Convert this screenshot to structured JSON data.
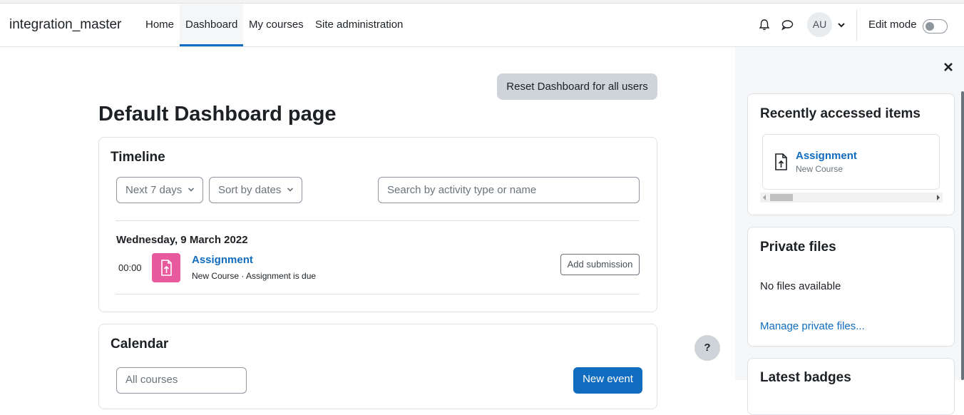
{
  "navbar": {
    "brand": "integration_master",
    "links": [
      "Home",
      "Dashboard",
      "My courses",
      "Site administration"
    ],
    "active": "Dashboard",
    "avatar_initials": "AU",
    "edit_mode_label": "Edit mode",
    "edit_mode_on": false
  },
  "page": {
    "reset_button": "Reset Dashboard for all users",
    "title": "Default Dashboard page"
  },
  "timeline": {
    "title": "Timeline",
    "day_filter": "Next 7 days",
    "sort": "Sort by dates",
    "search_placeholder": "Search by activity type or name",
    "date_heading": "Wednesday, 9 March 2022",
    "item": {
      "time": "00:00",
      "name": "Assignment",
      "detail": "New Course · Assignment is due",
      "action": "Add submission"
    }
  },
  "calendar": {
    "title": "Calendar",
    "course_select": "All courses",
    "new_event": "New event"
  },
  "help_button": "?",
  "drawer": {
    "recent": {
      "title": "Recently accessed items",
      "item_name": "Assignment",
      "item_course": "New Course"
    },
    "private_files": {
      "title": "Private files",
      "empty_text": "No files available",
      "manage_link": "Manage private files..."
    },
    "badges": {
      "title": "Latest badges"
    }
  },
  "colors": {
    "primary": "#0f6cbf",
    "assignment_icon_bg": "#e85a9e"
  }
}
